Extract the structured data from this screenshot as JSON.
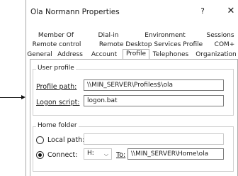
{
  "window": {
    "title": "Ola Normann Properties",
    "help": "?",
    "close": "✕"
  },
  "tabs": [
    {
      "label": "Member Of"
    },
    {
      "label": "Dial-in"
    },
    {
      "label": "Environment"
    },
    {
      "label": "Sessions"
    },
    {
      "label": "Remote control"
    },
    {
      "label": "Remote Desktop Services Profile"
    },
    {
      "label": "COM+"
    },
    {
      "label": "General"
    },
    {
      "label": "Address"
    },
    {
      "label": "Account"
    },
    {
      "label": "Profile"
    },
    {
      "label": "Telephones"
    },
    {
      "label": "Organization"
    }
  ],
  "active_tab": "Profile",
  "user_profile": {
    "legend": "User profile",
    "profile_path_label": "Profile path:",
    "profile_path_value": "\\\\MIN_SERVER\\Profiles$\\ola",
    "logon_script_label": "Logon script:",
    "logon_script_value": "logon.bat"
  },
  "home_folder": {
    "legend": "Home folder",
    "local_path_label": "Local path:",
    "local_path_value": "",
    "connect_label": "Connect:",
    "drive_value": "H:",
    "to_label": "To:",
    "to_value": "\\\\MIN_SERVER\\Home\\ola",
    "selected": "connect"
  },
  "icons": {
    "arrow": "arrow-right-pointer",
    "dropdown": "chevron-down-icon"
  }
}
